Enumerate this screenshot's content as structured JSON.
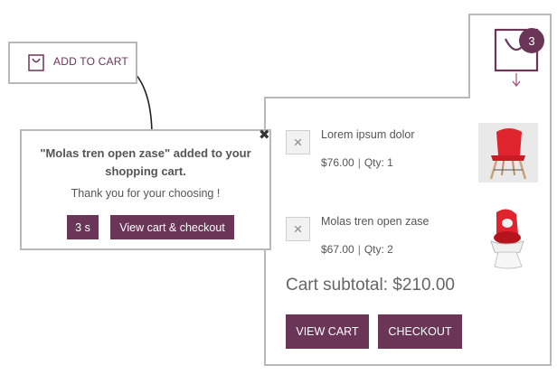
{
  "add_to_cart": {
    "label": "ADD TO CART",
    "icon": "shopping-bag-icon"
  },
  "popup": {
    "close_glyph": "✖",
    "title_line1": "\"Molas tren open zase\" added to your",
    "title_line2": "shopping cart.",
    "thanks": "Thank you for your choosing !",
    "countdown": "3 s",
    "checkout_label": "View cart & checkout"
  },
  "mini_cart": {
    "count": "3",
    "icon": "cart-bag-icon",
    "items": [
      {
        "name": "Lorem ipsum dolor",
        "price": "$76.00",
        "qty": "Qty: 1",
        "remove": "×",
        "image": "red-chair-image"
      },
      {
        "name": "Molas tren open zase",
        "price": "$67.00",
        "qty": "Qty: 2",
        "remove": "×",
        "image": "red-lounge-chair-image"
      }
    ],
    "subtotal": "Cart subtotal: $210.00",
    "view_cart_label": "VIEW CART",
    "checkout_label": "CHECKOUT"
  },
  "colors": {
    "accent": "#6a3556",
    "border": "#b9b9b9",
    "chair_red": "#e0242e"
  }
}
